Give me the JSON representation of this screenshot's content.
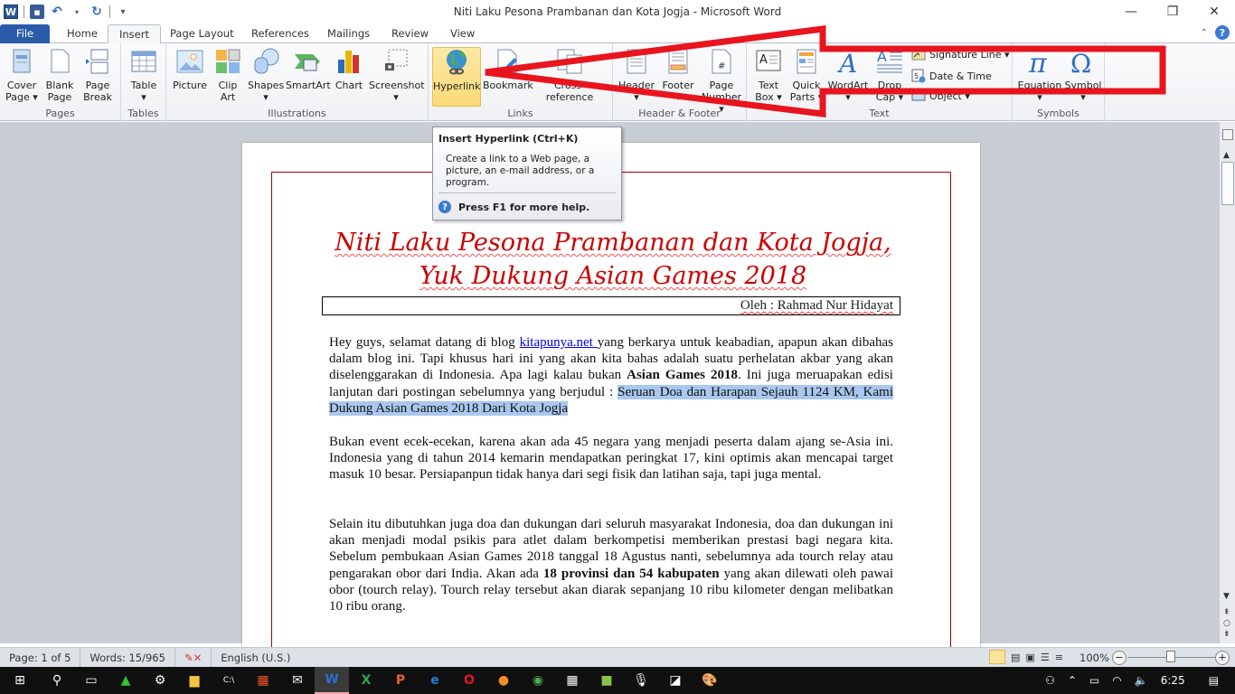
{
  "window": {
    "title": "Niti Laku Pesona Prambanan dan Kota Jogja  -  Microsoft Word",
    "controls": {
      "minimize": "—",
      "restore": "❐",
      "close": "✕"
    }
  },
  "quick_access": {
    "logo": "W",
    "save": "💾",
    "undo": "↶",
    "redo": "↻",
    "customize": "▾"
  },
  "tabs": [
    {
      "label": "File"
    },
    {
      "label": "Home"
    },
    {
      "label": "Insert"
    },
    {
      "label": "Page Layout"
    },
    {
      "label": "References"
    },
    {
      "label": "Mailings"
    },
    {
      "label": "Review"
    },
    {
      "label": "View"
    }
  ],
  "help": {
    "collapse": "⌃",
    "help": "?"
  },
  "ribbon": {
    "groups": [
      {
        "label": "Pages",
        "buttons": [
          "Cover\nPage ▾",
          "Blank\nPage",
          "Page\nBreak"
        ]
      },
      {
        "label": "Tables",
        "buttons": [
          "Table\n▾"
        ]
      },
      {
        "label": "Illustrations",
        "buttons": [
          "Picture",
          "Clip\nArt",
          "Shapes\n▾",
          "SmartArt",
          "Chart",
          "Screenshot\n▾"
        ]
      },
      {
        "label": "Links",
        "buttons": [
          "Hyperlink",
          "Bookmark",
          "Cross-reference"
        ]
      },
      {
        "label": "Header & Footer",
        "buttons": [
          "Header\n▾",
          "Footer\n▾",
          "Page\nNumber ▾"
        ]
      },
      {
        "label": "Text",
        "buttons": [
          "Text\nBox ▾",
          "Quick\nParts ▾",
          "WordArt\n▾",
          "Drop\nCap ▾"
        ],
        "small": [
          "Signature Line ▾",
          "Date & Time",
          "Object ▾"
        ]
      },
      {
        "label": "Symbols",
        "buttons": [
          "Equation\n▾",
          "Symbol\n▾"
        ]
      }
    ]
  },
  "tooltip": {
    "title": "Insert Hyperlink (Ctrl+K)",
    "body": "Create a link to a Web page, a picture, an e-mail address, or a program.",
    "help": "Press F1 for more help."
  },
  "document": {
    "title": "Niti Laku Pesona Prambanan dan Kota Jogja, Yuk Dukung Asian Games 2018",
    "author": "Oleh : Rahmad Nur Hidayat",
    "p1": {
      "a": "Hey guys, selamat datang di blog ",
      "link": "kitapunya.net ",
      "b": "yang berkarya untuk keabadian, apapun akan dibahas dalam blog ini. Tapi khusus hari ini yang akan kita bahas adalah suatu perhelatan akbar yang akan diselenggarakan di Indonesia. Apa lagi kalau bukan ",
      "bold": "Asian Games 2018",
      "c": ". Ini juga meruapakan edisi lanjutan dari postingan sebelumnya yang berjudul : ",
      "selected": "Seruan Doa dan Harapan Sejauh 1124 KM, Kami Dukung Asian Games 2018 Dari Kota Jogja "
    },
    "p2": "Bukan event ecek-ecekan, karena akan ada 45 negara yang menjadi peserta dalam ajang se-Asia ini. Indonesia yang di tahun 2014 kemarin mendapatkan peringkat 17, kini optimis akan mencapai target masuk 10 besar. Persiapanpun tidak hanya dari segi fisik dan latihan saja, tapi juga mental.",
    "p3": {
      "a": "Selain itu dibutuhkan juga doa dan dukungan dari seluruh masyarakat Indonesia, doa dan dukungan ini akan menjadi modal psikis para atlet dalam berkompetisi memberikan prestasi bagi negara kita. Sebelum pembukaan Asian Games 2018 tanggal 18 Agustus nanti, sebelumnya ada tourch relay atau pengarakan obor dari India. Akan ada ",
      "bold": "18 provinsi dan 54 kabupaten",
      "b": " yang akan dilewati oleh pawai obor (tourch relay). Tourch relay tersebut akan diarak sepanjang 10 ribu kilometer dengan melibatkan 10 ribu orang."
    }
  },
  "status": {
    "page": "Page: 1 of 5",
    "words": "Words: 15/965",
    "language": "English (U.S.)",
    "zoom": "100%",
    "zoom_level_percent": 100
  },
  "taskbar": {
    "time": "6:25",
    "apps": [
      "start",
      "search",
      "task-view",
      "app-green",
      "settings",
      "file-explorer",
      "terminal",
      "store",
      "mail",
      "word",
      "excel",
      "powerpoint",
      "edge",
      "opera",
      "firefox",
      "chrome",
      "calculator",
      "app-green-2",
      "voice-recorder",
      "sticky",
      "paint"
    ]
  },
  "colors": {
    "accent": "#2a5ba8",
    "annotation": "#e8141e",
    "title_red": "#cc0000",
    "selection": "#a9c8ef"
  }
}
